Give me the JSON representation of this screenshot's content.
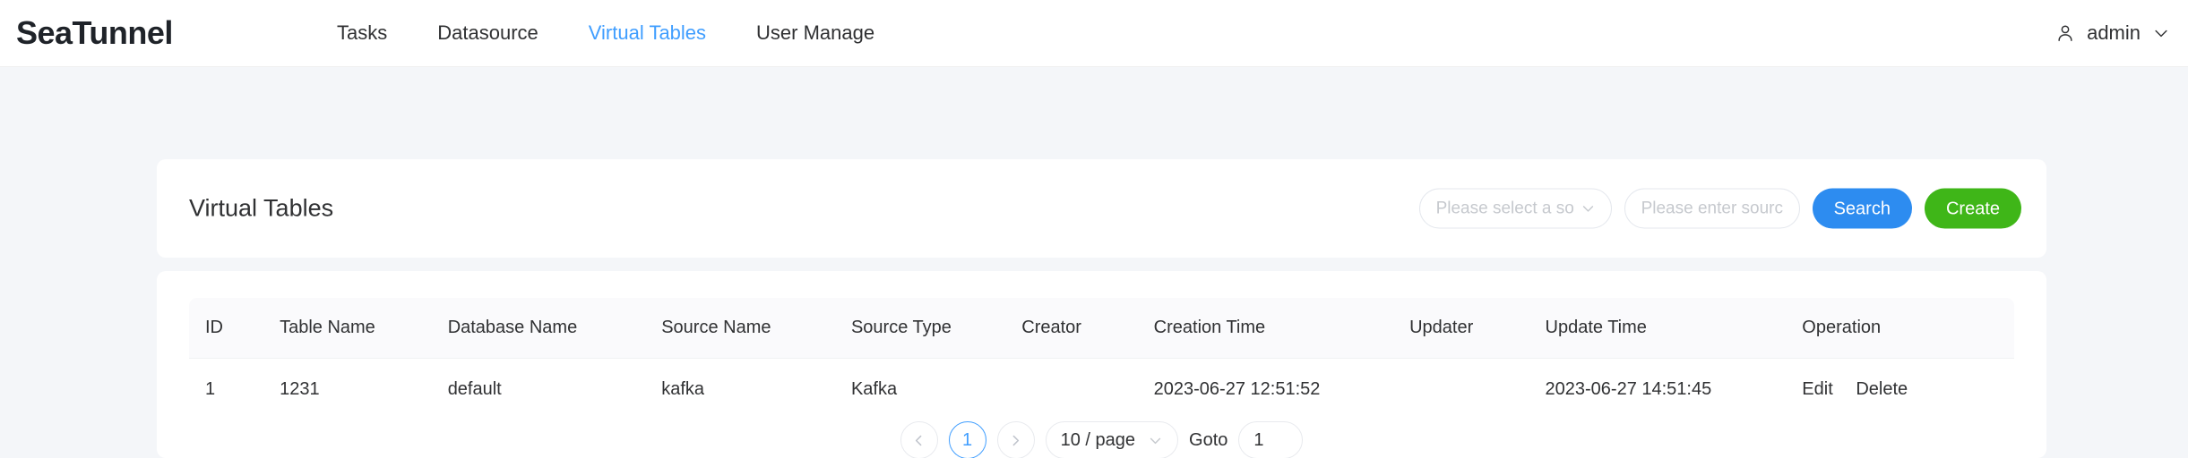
{
  "header": {
    "brand": "SeaTunnel",
    "nav": [
      {
        "label": "Tasks",
        "active": false
      },
      {
        "label": "Datasource",
        "active": false
      },
      {
        "label": "Virtual Tables",
        "active": true
      },
      {
        "label": "User Manage",
        "active": false
      }
    ],
    "user": {
      "name": "admin",
      "avatar_icon": "user-icon",
      "caret_icon": "chevron-down-icon"
    }
  },
  "panel": {
    "title": "Virtual Tables",
    "source_type_select": {
      "placeholder": "Please select a source type",
      "value": "",
      "caret_icon": "chevron-down-icon"
    },
    "source_name_input": {
      "placeholder": "Please enter source name",
      "value": ""
    },
    "search_button": "Search",
    "create_button": "Create"
  },
  "table": {
    "columns": [
      "ID",
      "Table Name",
      "Database Name",
      "Source Name",
      "Source Type",
      "Creator",
      "Creation Time",
      "Updater",
      "Update Time",
      "Operation"
    ],
    "rows": [
      {
        "id": "1",
        "table_name": "1231",
        "database_name": "default",
        "source_name": "kafka",
        "source_type": "Kafka",
        "creator": "",
        "creation_time": "2023-06-27 12:51:52",
        "updater": "",
        "update_time": "2023-06-27 14:51:45",
        "operations": [
          "Edit",
          "Delete"
        ]
      }
    ]
  },
  "pagination": {
    "prev_icon": "chevron-left-icon",
    "next_icon": "chevron-right-icon",
    "pages": [
      "1"
    ],
    "current_page": "1",
    "page_size_label": "10 / page",
    "page_size_caret_icon": "chevron-down-icon",
    "goto_label": "Goto",
    "goto_value": "1"
  },
  "colors": {
    "accent_blue": "#409eff",
    "search_blue": "#2d8cf0",
    "create_green": "#3fb618",
    "page_bg": "#f4f6f9",
    "card_bg": "#ffffff",
    "table_head_bg": "#fafafc",
    "text_primary": "#303133",
    "text_placeholder": "#c6c9ce"
  }
}
